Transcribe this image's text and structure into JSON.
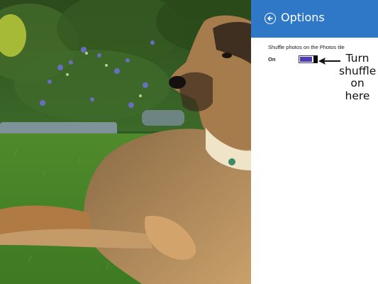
{
  "panel": {
    "title": "Options",
    "header_color": "#2f77c7",
    "back_icon": "back-arrow-circle-icon",
    "setting": {
      "label": "Shuffle photos on the Photos tile",
      "state": "On",
      "toggle_on": true,
      "toggle_level": 1.0,
      "accent_color": "#4e3bb5"
    }
  },
  "annotation": {
    "text": "Turn\nshuffle\non\nhere",
    "arrow_icon": "arrow-left-icon"
  },
  "background": {
    "subject": "dog-lying-on-grass-photo"
  }
}
